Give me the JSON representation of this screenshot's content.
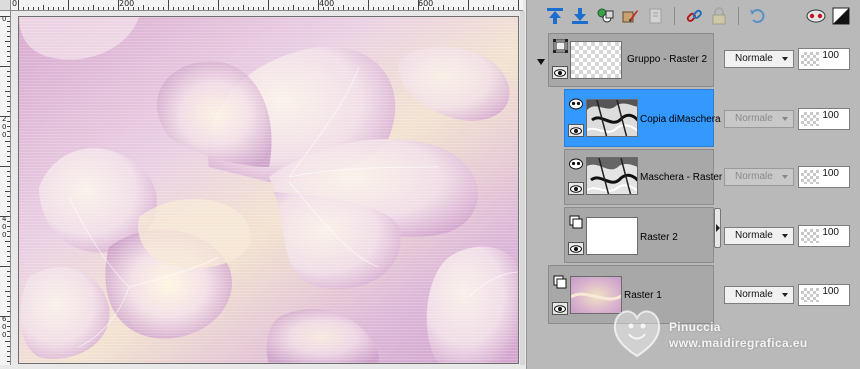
{
  "ruler": {
    "top_labels": [
      "0",
      "200",
      "400",
      "600"
    ],
    "left_labels": [
      [
        "0"
      ],
      [
        "2",
        "0",
        "0"
      ],
      [
        "4",
        "0",
        "0"
      ],
      [
        "6",
        "0",
        "0"
      ]
    ]
  },
  "toolbar": {
    "icons": [
      "move-layer-up-icon",
      "move-layer-down-icon",
      "link-icon-green",
      "brush-icon",
      "new-layer-icon-disabled",
      "chain-link-icon",
      "lock-icon-disabled",
      "undo-arrow-icon",
      "mask-toggle-icon",
      "contrast-icon"
    ]
  },
  "layers": [
    {
      "name": "Gruppo - Raster 2",
      "type": "group",
      "blend": "Normale",
      "blend_disabled": false,
      "opacity": "100",
      "selected": false
    },
    {
      "name": "Copia diMaschera",
      "type": "mask",
      "blend": "Normale",
      "blend_disabled": true,
      "opacity": "100",
      "selected": true
    },
    {
      "name": "Maschera - Raster",
      "type": "mask",
      "blend": "Normale",
      "blend_disabled": true,
      "opacity": "100",
      "selected": false
    },
    {
      "name": "Raster 2",
      "type": "raster",
      "blend": "Normale",
      "blend_disabled": false,
      "opacity": "100",
      "selected": false
    },
    {
      "name": "Raster 1",
      "type": "raster",
      "blend": "Normale",
      "blend_disabled": false,
      "opacity": "100",
      "selected": false
    }
  ],
  "watermark": {
    "name": "Pinuccia",
    "site": "www.maidiregrafica.eu"
  },
  "colors": {
    "selected": "#3399ff",
    "panel": "#b9b9b9",
    "layer_block": "#a8a8a8"
  }
}
